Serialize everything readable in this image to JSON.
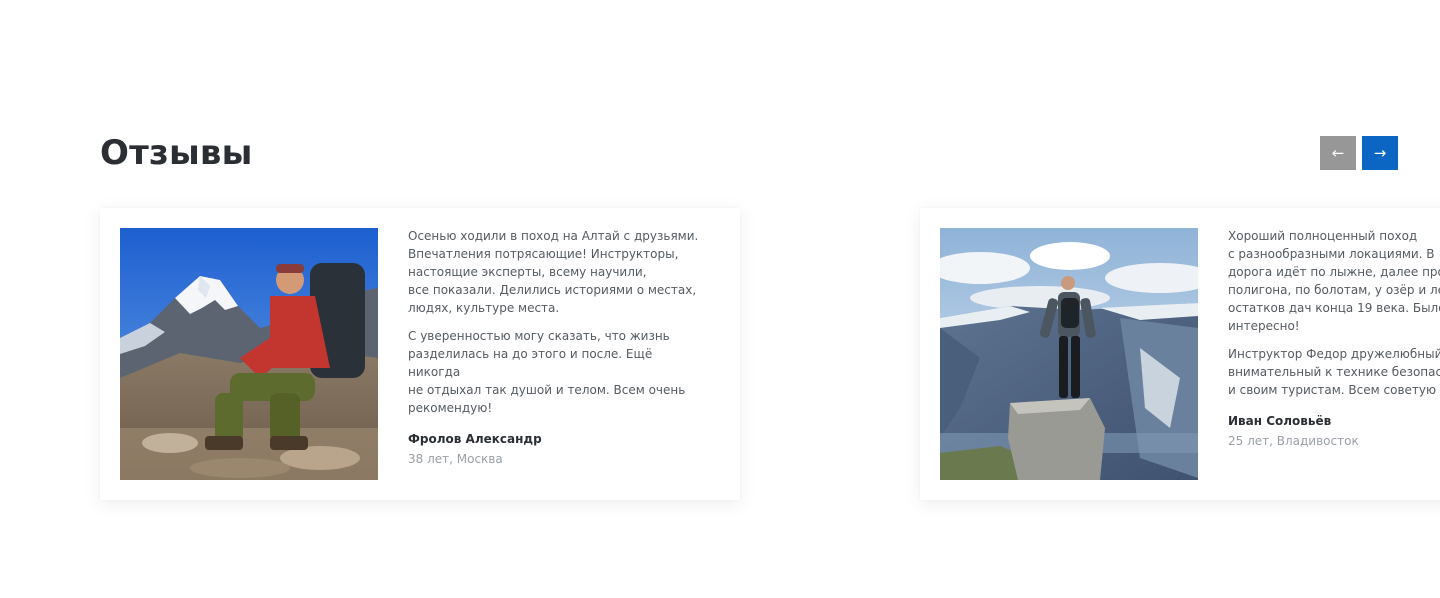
{
  "section": {
    "title": "Отзывы"
  },
  "nav": {
    "prev_icon": "arrow-left-icon",
    "prev_glyph": "←",
    "next_icon": "arrow-right-icon",
    "next_glyph": "→",
    "prev_color": "#979797",
    "next_color": "#0a66c2"
  },
  "reviews": [
    {
      "photo": "hiker-sitting-mountains-photo",
      "paragraphs": [
        "Осенью ходили в поход на Алтай с друзьями.\nВпечатления потрясающие! Инструкторы,\nнастоящие эксперты, всему научили,\nвсе показали. Делились историями о местах,\nлюдях, культуре места.",
        "С уверенностью могу сказать, что жизнь\nразделилась на до этого и после. Ещё никогда\nне отдыхал так душой и телом. Всем очень\nрекомендую!"
      ],
      "author": "Фролов Александр",
      "meta": "38 лет, Москва"
    },
    {
      "photo": "hiker-standing-cliff-photo",
      "paragraphs": [
        "Хороший полноценный поход\nс разнообразными локациями. В\nдорога идёт по лыжне, далее про\nполигона, по болотам, у озёр и ле\nостатков дач конца 19 века. Было о\nинтересно!",
        "Инструктор Федор дружелюбный\nвнимательный к технике безопас\nи своим туристам. Всем советую э"
      ],
      "author": "Иван Соловьёв",
      "meta": "25 лет, Владивосток"
    }
  ]
}
